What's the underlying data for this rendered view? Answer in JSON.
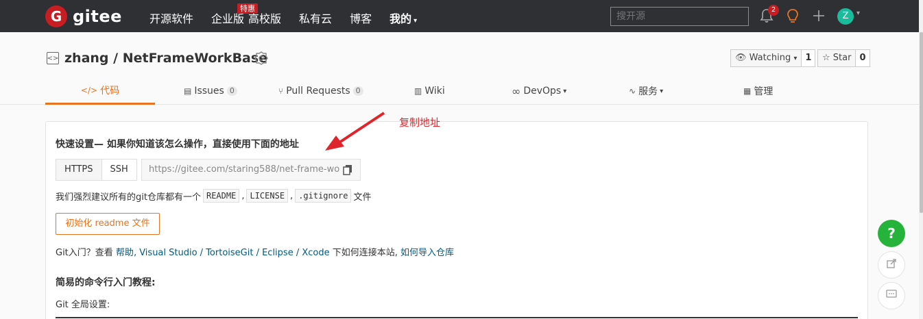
{
  "topbar": {
    "logo_text": "gitee",
    "logo_letter": "G",
    "nav": [
      {
        "label": "开源软件"
      },
      {
        "label": "企业版",
        "badge": "特惠"
      },
      {
        "label": "高校版"
      },
      {
        "label": "私有云"
      },
      {
        "label": "博客"
      },
      {
        "label": "我的"
      }
    ],
    "search_placeholder": "搜开源",
    "notification_count": "2",
    "avatar_letter": "Z"
  },
  "repo": {
    "owner": "zhang",
    "separator": " / ",
    "name": "NetFrameWorkBase",
    "watch_label": "Watching",
    "watch_count": "1",
    "star_label": "Star",
    "star_count": "0"
  },
  "tabs": [
    {
      "label": "代码",
      "icon": "code-icon"
    },
    {
      "label": "Issues",
      "count": "0"
    },
    {
      "label": "Pull Requests",
      "count": "0"
    },
    {
      "label": "Wiki"
    },
    {
      "label": "DevOps"
    },
    {
      "label": "服务"
    },
    {
      "label": "管理"
    }
  ],
  "quick_setup": {
    "title": "快速设置— 如果你知道该怎么操作，直接使用下面的地址",
    "protocols": [
      "HTTPS",
      "SSH"
    ],
    "url": "https://gitee.com/staring588/net-frame-wo",
    "recommend_prefix": "我们强烈建议所有的git仓库都有一个",
    "files": [
      "README",
      "LICENSE",
      ".gitignore"
    ],
    "recommend_suffix": "文件",
    "init_button": "初始化 readme 文件",
    "intro_prefix": "Git入门？查看 ",
    "intro_help": "帮助",
    "intro_tools": ", Visual Studio / TortoiseGit / Eclipse / Xcode",
    "intro_middle": " 下如何连接本站, ",
    "intro_import": "如何导入仓库",
    "cmd_title": "简易的命令行入门教程:",
    "git_global": "Git 全局设置:"
  },
  "annotation": {
    "text": "复制地址",
    "color": "#e0242b"
  },
  "float": {
    "help_label": "?"
  },
  "colors": {
    "brand": "#c71d23",
    "accent": "#e8731f",
    "topbar": "#2e3033",
    "help": "#26b33b",
    "link": "#005980"
  }
}
